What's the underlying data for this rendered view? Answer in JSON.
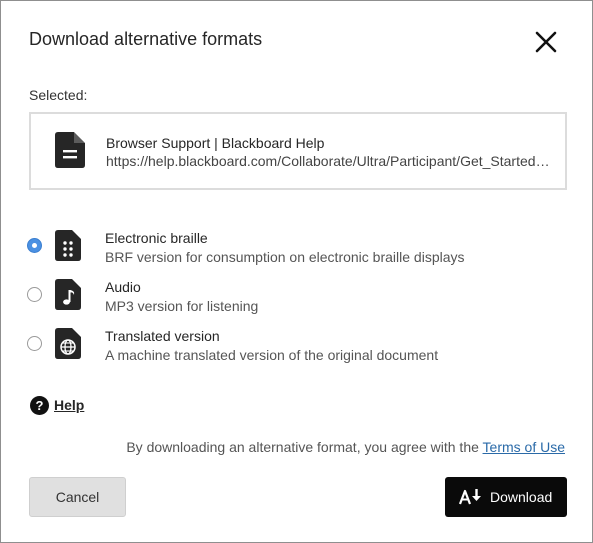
{
  "dialog": {
    "title": "Download alternative formats",
    "close_icon": "close-icon"
  },
  "selected": {
    "label": "Selected:",
    "doc_title": "Browser Support | Blackboard Help",
    "doc_url": "https://help.blackboard.com/Collaborate/Ultra/Participant/Get_Started/Browser_Support",
    "icon": "document-icon"
  },
  "options": [
    {
      "title": "Electronic braille",
      "description": "BRF version for consumption on electronic braille displays",
      "icon": "braille-file-icon",
      "checked": true
    },
    {
      "title": "Audio",
      "description": "MP3 version for listening",
      "icon": "audio-file-icon",
      "checked": false
    },
    {
      "title": "Translated version",
      "description": "A machine translated version of the original document",
      "icon": "translated-file-icon",
      "checked": false
    }
  ],
  "help": {
    "label": "Help",
    "icon": "help-icon"
  },
  "terms": {
    "prefix": "By downloading an alternative format, you agree with the ",
    "link": "Terms of Use"
  },
  "buttons": {
    "cancel": "Cancel",
    "download": "Download",
    "download_icon": "download-icon"
  },
  "colors": {
    "accent": "#2f7ad7",
    "link": "#2a6aa8",
    "primary_button": "#0a0a0a"
  }
}
